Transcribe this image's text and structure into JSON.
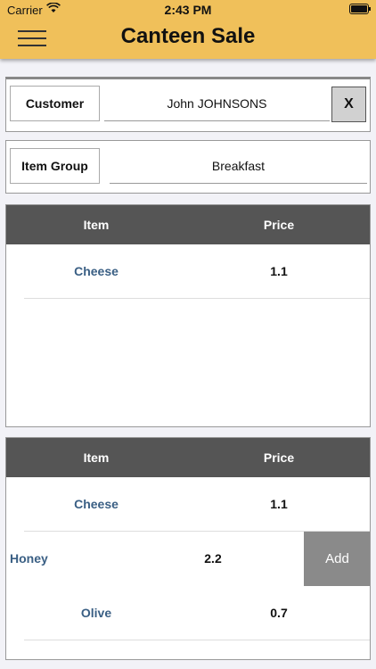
{
  "status_bar": {
    "carrier": "Carrier",
    "time": "2:43 PM"
  },
  "header": {
    "title": "Canteen Sale",
    "menu_icon": "hamburger-menu-icon"
  },
  "customer": {
    "label": "Customer",
    "value": "John JOHNSONS",
    "clear_label": "X"
  },
  "item_group": {
    "label": "Item Group",
    "value": "Breakfast"
  },
  "selected_items": {
    "columns": [
      "Item",
      "Price"
    ],
    "rows": [
      {
        "item": "Cheese",
        "price": "1.1"
      }
    ]
  },
  "available_items": {
    "columns": [
      "Item",
      "Price"
    ],
    "rows": [
      {
        "item": "Cheese",
        "price": "1.1"
      },
      {
        "item": "Honey",
        "price": "2.2",
        "action": "Add"
      },
      {
        "item": "Olive",
        "price": "0.7"
      }
    ]
  },
  "colors": {
    "header_bg": "#f0c05a",
    "table_header_bg": "#555555",
    "item_text": "#3a5f84",
    "add_button_bg": "#8a8a8a"
  }
}
